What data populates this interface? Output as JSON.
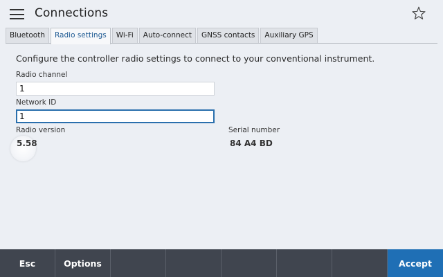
{
  "header": {
    "title": "Connections",
    "menu_icon": "hamburger-menu-icon",
    "favorite_icon": "star-icon"
  },
  "tabs": [
    {
      "label": "Bluetooth",
      "active": false
    },
    {
      "label": "Radio settings",
      "active": true
    },
    {
      "label": "Wi-Fi",
      "active": false
    },
    {
      "label": "Auto-connect",
      "active": false
    },
    {
      "label": "GNSS contacts",
      "active": false
    },
    {
      "label": "Auxiliary GPS",
      "active": false
    }
  ],
  "main": {
    "description": "Configure the controller radio settings to connect to your conventional instrument.",
    "radio_channel": {
      "label": "Radio channel",
      "value": "1"
    },
    "network_id": {
      "label": "Network ID",
      "value": "1"
    },
    "radio_version": {
      "label": "Radio version",
      "value": "5.58"
    },
    "serial_number": {
      "label": "Serial number",
      "value": "84 A4 BD"
    }
  },
  "softkeys": {
    "esc": "Esc",
    "options": "Options",
    "accept": "Accept"
  },
  "colors": {
    "background": "#eceff4",
    "tab_active_text": "#1e5a93",
    "bottom_bar": "#40454f",
    "accept": "#1f6fb5",
    "focus_border": "#2a6fad"
  }
}
